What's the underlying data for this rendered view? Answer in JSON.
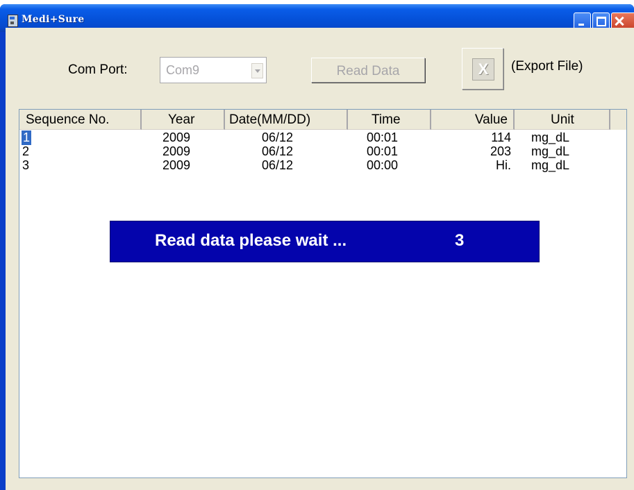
{
  "app": {
    "title": "Medi+Sure"
  },
  "controls": {
    "com_port_label": "Com Port:",
    "com_port_value": "Com9",
    "read_button_label": "Read Data",
    "export_label": "(Export File)"
  },
  "table": {
    "headers": [
      "Sequence No.",
      "Year",
      "Date(MM/DD)",
      "Time",
      "Value",
      "Unit"
    ],
    "rows": [
      {
        "seq": "1",
        "year": "2009",
        "date": "06/12",
        "time": "00:01",
        "value": "114",
        "unit": "mg_dL"
      },
      {
        "seq": "2",
        "year": "2009",
        "date": "06/12",
        "time": "00:01",
        "value": "203",
        "unit": "mg_dL"
      },
      {
        "seq": "3",
        "year": "2009",
        "date": "06/12",
        "time": "00:00",
        "value": "Hi.",
        "unit": "mg_dL"
      }
    ]
  },
  "status": {
    "message": "Read data please wait ...",
    "count": "3"
  },
  "colors": {
    "titlebar": "#0551d9",
    "window_bg": "#ece9d8",
    "wait_box": "#0404ac",
    "selection": "#316ac5"
  }
}
